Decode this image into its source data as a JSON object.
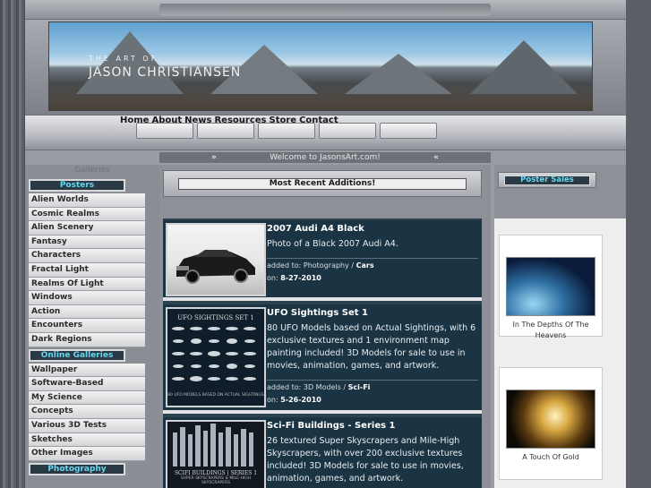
{
  "banner": {
    "subtitle": "THE ART OF",
    "title": "JASON CHRISTIANSEN"
  },
  "nav": {
    "links": [
      "Home",
      "About",
      "News",
      "Resources",
      "Store",
      "Contact"
    ]
  },
  "welcome": {
    "text": "Welcome to JasonsArt.com!",
    "left_arrow": "»",
    "right_arrow": "«"
  },
  "sidebar": {
    "heading": "Galleries",
    "sections": [
      {
        "title": "Posters",
        "items": [
          "Alien Worlds",
          "Cosmic Realms",
          "Alien Scenery",
          "Fantasy",
          "Characters",
          "Fractal Light",
          "Realms Of Light",
          "Windows",
          "Action",
          "Encounters",
          "Dark Regions"
        ]
      },
      {
        "title": "Online Galleries",
        "items": [
          "Wallpaper",
          "Software-Based",
          "My Science",
          "Concepts",
          "Various 3D Tests",
          "Sketches",
          "Other Images"
        ]
      },
      {
        "title": "Photography",
        "items": []
      }
    ]
  },
  "center": {
    "recent_label": "Most Recent Additions!",
    "items": [
      {
        "title": "2007 Audi A4 Black",
        "desc": "Photo of a Black 2007 Audi A4.",
        "added_label": "added to:",
        "category": "Photography",
        "subcategory": "Cars",
        "on_label": "on:",
        "date": "8-27-2010",
        "thumb_icon": "car-photo"
      },
      {
        "title": "UFO Sightings Set 1",
        "desc": "80 UFO Models based on Actual Sightings, with 6 exclusive textures and 1 environment map painting included! 3D Models for sale to use in movies, animation, games, and artwork.",
        "added_label": "added to:",
        "category": "3D Models",
        "subcategory": "Sci-Fi",
        "on_label": "on:",
        "date": "5-26-2010",
        "thumb_title": "UFO SIGHTINGS SET 1",
        "thumb_caption": "80 UFO MODELS BASED ON ACTUAL SIGHTINGS"
      },
      {
        "title": "Sci-Fi Buildings - Series 1",
        "desc": "26 textured Super Skyscrapers and Mile-High Skyscrapers, with over 200 exclusive textures included! 3D Models for sale to use in movies, animation, games, and artwork.",
        "thumb_title": "SCIFI BUILDINGS | SERIES 1",
        "thumb_caption": "SUPER SKYSCRAPERS & MILE-HIGH SKYSCRAPERS"
      }
    ]
  },
  "right": {
    "heading": "Poster Sales",
    "posters": [
      {
        "caption": "In The Depths Of The Heavens"
      },
      {
        "caption": "A Touch Of Gold"
      }
    ]
  },
  "colors": {
    "section_head_text": "#67d7f2",
    "card_bg": "#1b3443"
  }
}
